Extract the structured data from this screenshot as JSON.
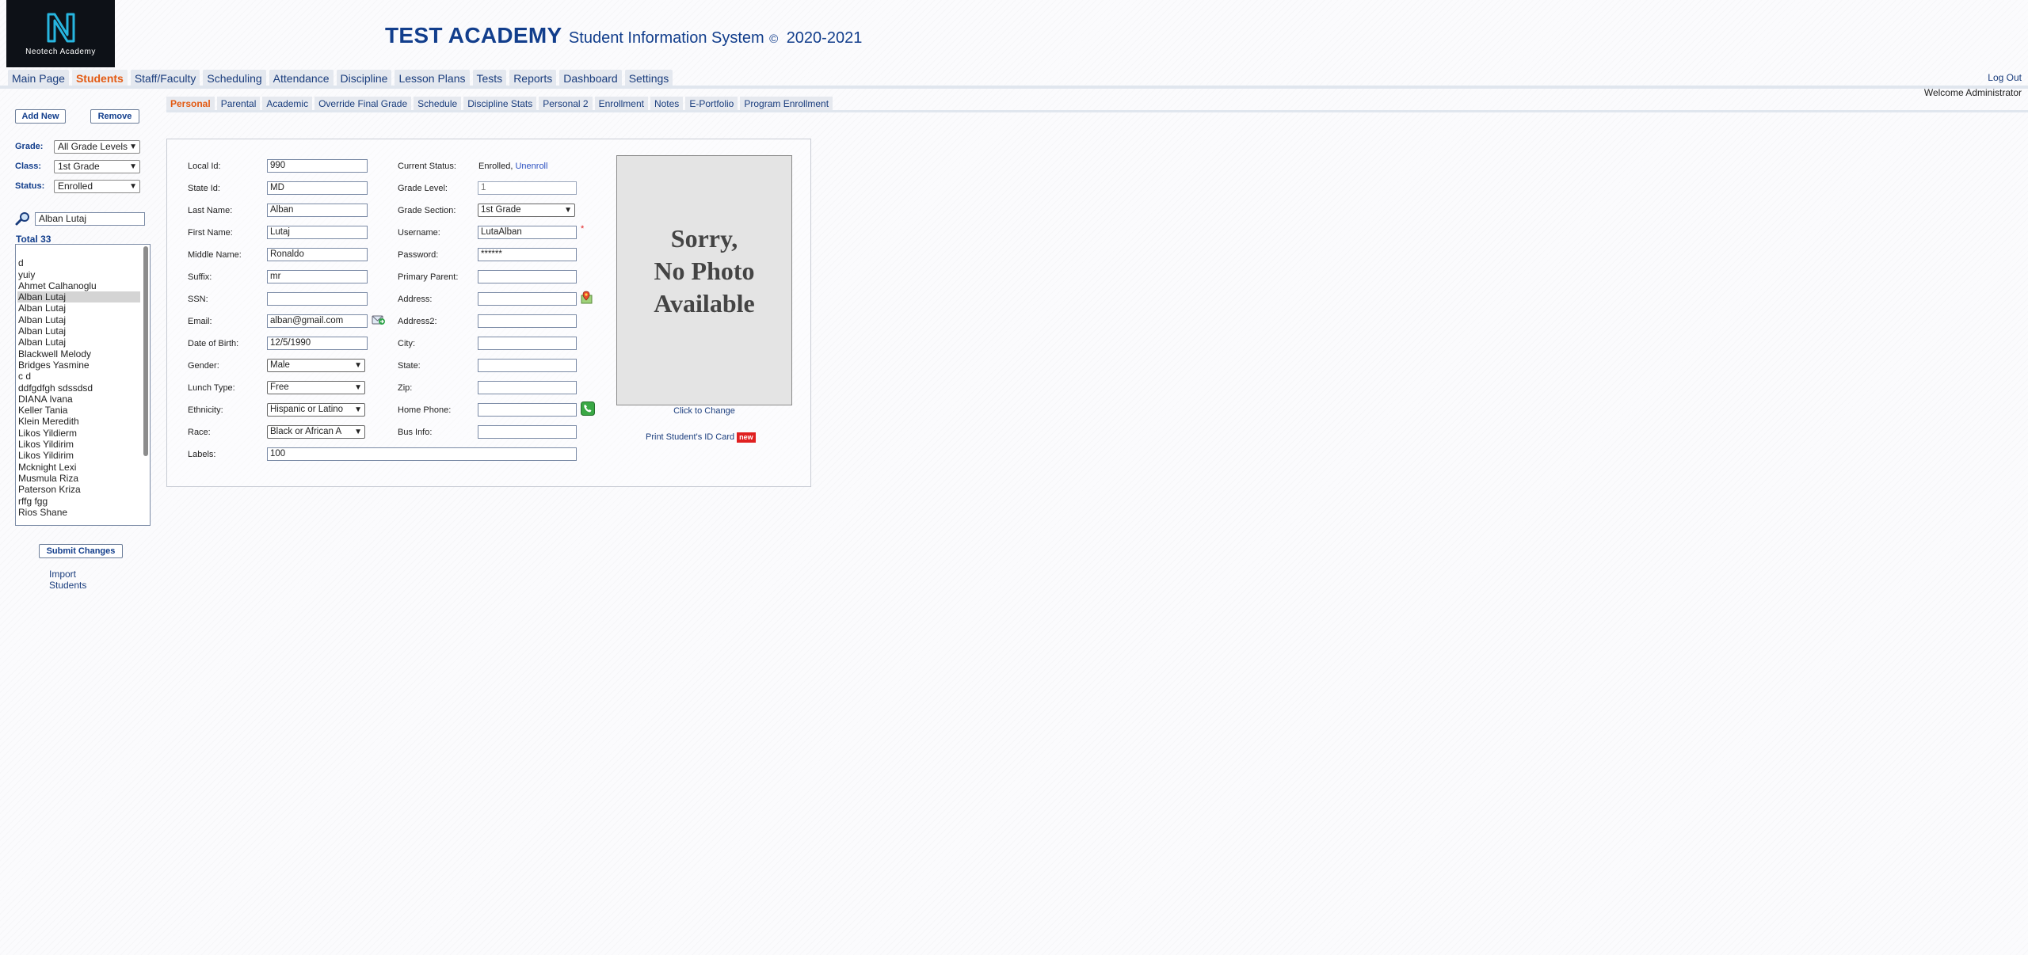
{
  "header": {
    "logo_text": "Neotech Academy",
    "school_name": "TEST ACADEMY",
    "system_title": "Student Information System",
    "copyright_symbol": "©",
    "year_range": "2020-2021",
    "logout_label": "Log Out",
    "welcome_text": "Welcome Administrator"
  },
  "main_nav": {
    "items": [
      "Main Page",
      "Students",
      "Staff/Faculty",
      "Scheduling",
      "Attendance",
      "Discipline",
      "Lesson Plans",
      "Tests",
      "Reports",
      "Dashboard",
      "Settings"
    ],
    "active": "Students"
  },
  "sub_tabs": {
    "items": [
      "Personal",
      "Parental",
      "Academic",
      "Override Final Grade",
      "Schedule",
      "Discipline Stats",
      "Personal 2",
      "Enrollment",
      "Notes",
      "E-Portfolio",
      "Program Enrollment"
    ],
    "active": "Personal"
  },
  "sidebar": {
    "add_new_label": "Add New",
    "remove_label": "Remove",
    "grade_label": "Grade:",
    "grade_value": "All Grade Levels",
    "class_label": "Class:",
    "class_value": "1st Grade",
    "status_label": "Status:",
    "status_value": "Enrolled",
    "search_value": "Alban Lutaj",
    "total_text": "Total 33 students",
    "students": [
      "",
      "d",
      "yuiy",
      "Ahmet Calhanoglu",
      "Alban Lutaj",
      "Alban Lutaj",
      "Alban Lutaj",
      "Alban Lutaj",
      "Alban Lutaj",
      "Blackwell Melody",
      "Bridges Yasmine",
      "c d",
      "ddfgdfgh sdssdsd",
      "DIANA Ivana",
      "Keller Tania",
      "Klein Meredith",
      "Likos Yildierm",
      "Likos Yildirim",
      "Likos Yildirim",
      "Mcknight Lexi",
      "Musmula Riza",
      "Paterson Kriza",
      "rffg fgg",
      "Rios Shane"
    ],
    "selected_index": 4,
    "submit_label": "Submit Changes",
    "import_label": "Import Students"
  },
  "form": {
    "local_id_label": "Local Id:",
    "local_id": "990",
    "state_id_label": "State Id:",
    "state_id": "MD",
    "last_name_label": "Last Name:",
    "last_name": "Alban",
    "first_name_label": "First Name:",
    "first_name": "Lutaj",
    "middle_name_label": "Middle Name:",
    "middle_name": "Ronaldo",
    "suffix_label": "Suffix:",
    "suffix": "mr",
    "ssn_label": "SSN:",
    "ssn": "",
    "email_label": "Email:",
    "email": "alban@gmail.com",
    "dob_label": "Date of Birth:",
    "dob": "12/5/1990",
    "gender_label": "Gender:",
    "gender": "Male",
    "lunch_label": "Lunch Type:",
    "lunch": "Free",
    "ethnicity_label": "Ethnicity:",
    "ethnicity": "Hispanic or Latino",
    "race_label": "Race:",
    "race": "Black or African A",
    "labels_label": "Labels:",
    "labels": "100",
    "current_status_label": "Current Status:",
    "current_status": "Enrolled,",
    "unenroll_label": "Unenroll",
    "grade_level_label": "Grade Level:",
    "grade_level": "1",
    "grade_section_label": "Grade Section:",
    "grade_section": "1st Grade",
    "username_label": "Username:",
    "username": "LutaAlban",
    "required_mark": "*",
    "password_label": "Password:",
    "password": "******",
    "primary_parent_label": "Primary Parent:",
    "primary_parent": "",
    "address_label": "Address:",
    "address": "",
    "address2_label": "Address2:",
    "address2": "",
    "city_label": "City:",
    "city": "",
    "state_label": "State:",
    "state": "",
    "zip_label": "Zip:",
    "zip": "",
    "home_phone_label": "Home Phone:",
    "home_phone": "",
    "bus_info_label": "Bus Info:",
    "bus_info": ""
  },
  "photo": {
    "line1": "Sorry,",
    "line2": "No Photo",
    "line3": "Available",
    "click_to_change": "Click to Change",
    "print_id_label": "Print Student's ID Card",
    "new_badge": "new"
  },
  "icons": {
    "search": "magnifier-icon",
    "email_action": "email-compose-icon",
    "address_map": "map-pin-icon",
    "phone": "phone-icon"
  },
  "colors": {
    "brand_blue": "#123e8c",
    "active_orange": "#e35a12",
    "badge_red": "#e02020"
  }
}
